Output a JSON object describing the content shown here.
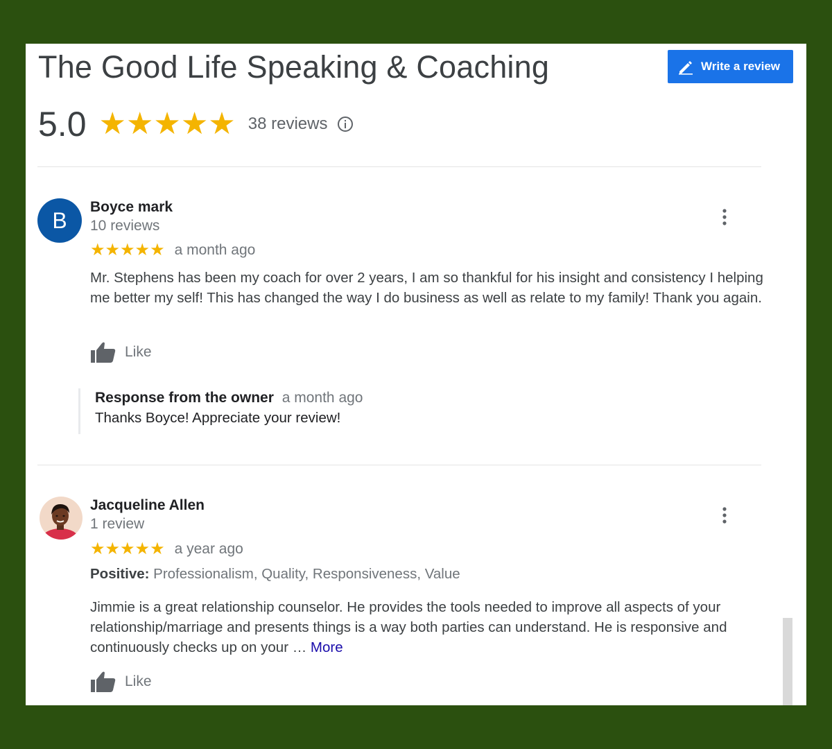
{
  "business": {
    "name": "The Good Life Speaking & Coaching",
    "rating": "5.0",
    "stars": "★★★★★",
    "review_count": "38 reviews",
    "write_review_label": "Write a review"
  },
  "reviews": [
    {
      "avatar_letter": "B",
      "name": "Boyce mark",
      "reviewer_count": "10 reviews",
      "stars": "★★★★★",
      "time": "a month ago",
      "text": "Mr. Stephens has been my coach for over 2 years, I am so thankful for his insight and consistency I helping me better my self! This has changed the way I do business as well as relate to my family! Thank you again.",
      "like_label": "Like",
      "owner_response": {
        "label": "Response from the owner",
        "time": "a month ago",
        "text": "Thanks Boyce! Appreciate your review!"
      }
    },
    {
      "name": "Jacqueline Allen",
      "reviewer_count": "1 review",
      "stars": "★★★★★",
      "time": "a year ago",
      "positive_label": "Positive:",
      "positive_text": "Professionalism, Quality, Responsiveness, Value",
      "text": "Jimmie is a great relationship counselor. He provides the tools needed to improve all aspects of your relationship/marriage and presents things is a way both parties can understand. He is responsive and continuously checks up on your … ",
      "more_label": "More",
      "like_label": "Like"
    }
  ],
  "colors": {
    "background": "#2b500f",
    "accent": "#1a73e8",
    "star": "#f4b400",
    "link": "#1a0dab"
  },
  "icons": [
    "pencil-icon",
    "star-icon",
    "info-icon",
    "more-vert-icon",
    "thumbs-up-icon"
  ]
}
